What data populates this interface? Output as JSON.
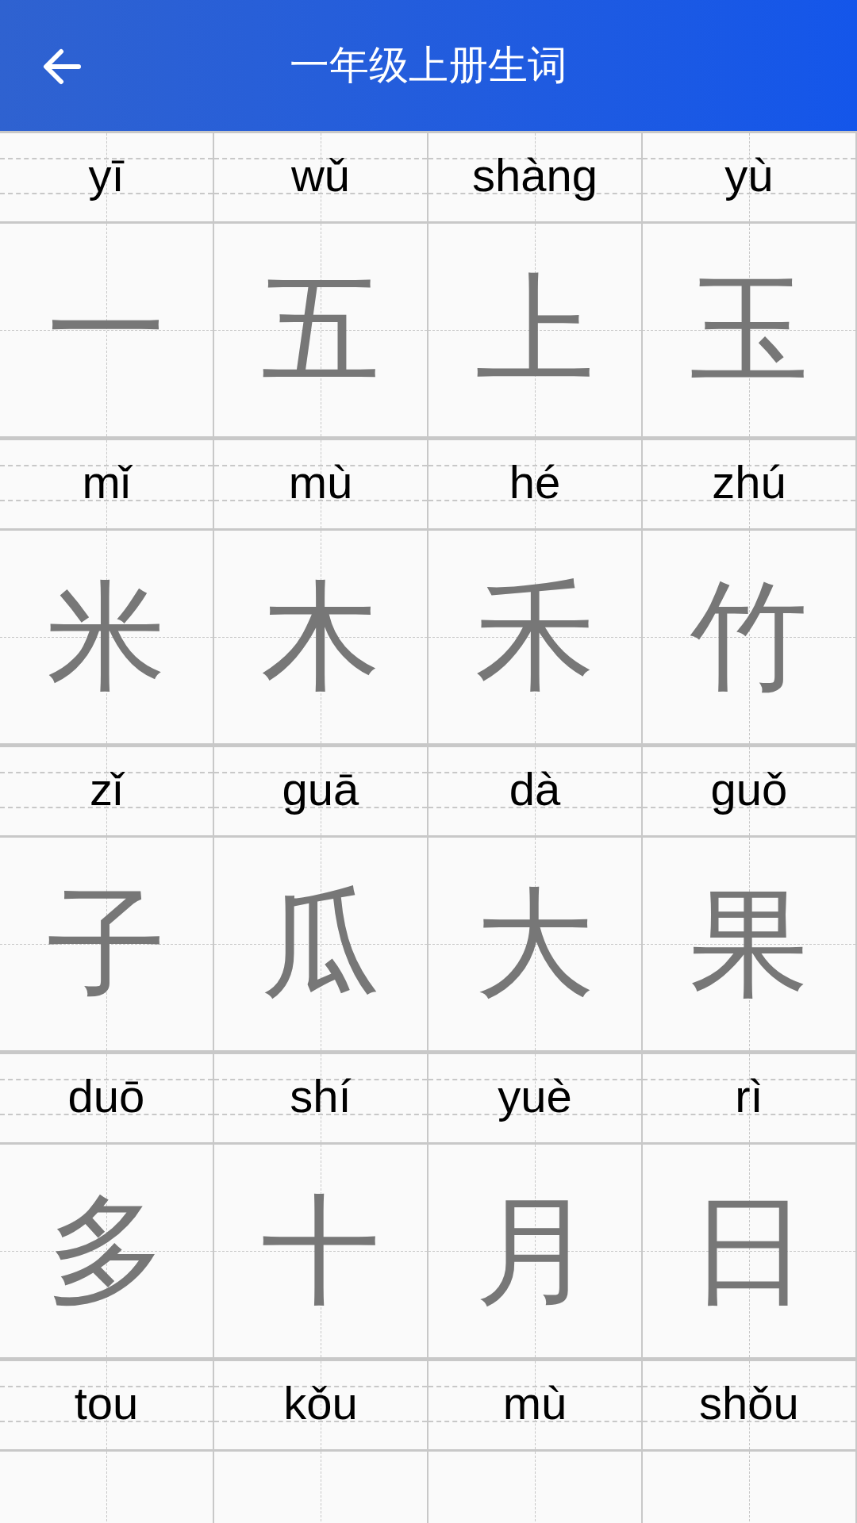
{
  "header": {
    "title": "一年级上册生词"
  },
  "words": [
    {
      "pinyin": "yī",
      "hanzi": "一"
    },
    {
      "pinyin": "wǔ",
      "hanzi": "五"
    },
    {
      "pinyin": "shàng",
      "hanzi": "上"
    },
    {
      "pinyin": "yù",
      "hanzi": "玉"
    },
    {
      "pinyin": "mǐ",
      "hanzi": "米"
    },
    {
      "pinyin": "mù",
      "hanzi": "木"
    },
    {
      "pinyin": "hé",
      "hanzi": "禾"
    },
    {
      "pinyin": "zhú",
      "hanzi": "竹"
    },
    {
      "pinyin": "zǐ",
      "hanzi": "子"
    },
    {
      "pinyin": "guā",
      "hanzi": "瓜"
    },
    {
      "pinyin": "dà",
      "hanzi": "大"
    },
    {
      "pinyin": "guǒ",
      "hanzi": "果"
    },
    {
      "pinyin": "duō",
      "hanzi": "多"
    },
    {
      "pinyin": "shí",
      "hanzi": "十"
    },
    {
      "pinyin": "yuè",
      "hanzi": "月"
    },
    {
      "pinyin": "rì",
      "hanzi": "日"
    },
    {
      "pinyin": "tou"
    },
    {
      "pinyin": "kǒu"
    },
    {
      "pinyin": "mù"
    },
    {
      "pinyin": "shǒu"
    }
  ]
}
